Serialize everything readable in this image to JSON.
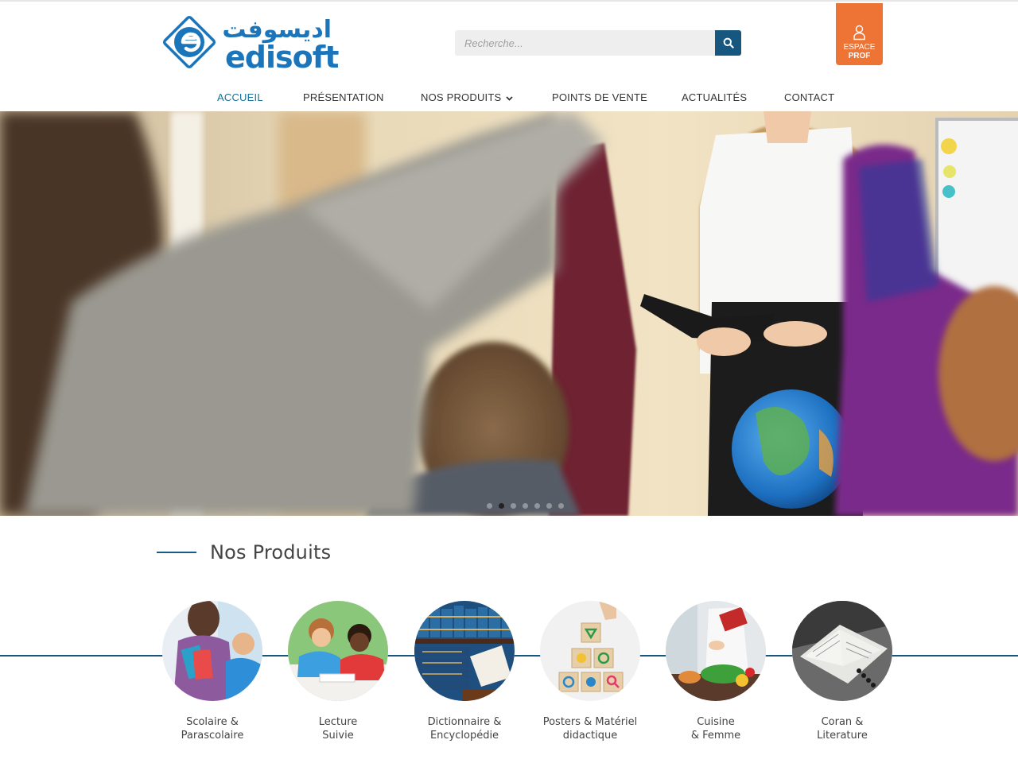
{
  "header": {
    "logo": {
      "arabic": "اديسوفت",
      "latin": "edisoft"
    },
    "search": {
      "placeholder": "Recherche..."
    },
    "espace_prof": {
      "line1": "ESPACE",
      "line2": "PROF"
    }
  },
  "nav": {
    "items": [
      {
        "label": "ACCUEIL",
        "active": true
      },
      {
        "label": "PRÉSENTATION"
      },
      {
        "label": "NOS PRODUITS"
      },
      {
        "label": "POINTS DE VENTE"
      },
      {
        "label": "ACTUALITÉS"
      },
      {
        "label": "CONTACT"
      }
    ]
  },
  "hero": {
    "slide_count": 7,
    "active_slide": 2
  },
  "products": {
    "title": "Nos Produits",
    "items": [
      {
        "line1": "Scolaire &",
        "line2": "Parascolaire"
      },
      {
        "line1": "Lecture",
        "line2": "Suivie"
      },
      {
        "line1": "Dictionnaire &",
        "line2": "Encyclopédie"
      },
      {
        "line1": "Posters & Matériel",
        "line2": "didactique"
      },
      {
        "line1": "Cuisine",
        "line2": "& Femme"
      },
      {
        "line1": "Coran &",
        "line2": "Literature"
      }
    ]
  },
  "colors": {
    "brand_blue": "#1b75bb",
    "dark_blue": "#17577f",
    "orange": "#ee7436",
    "active_nav": "#1a6f96"
  }
}
